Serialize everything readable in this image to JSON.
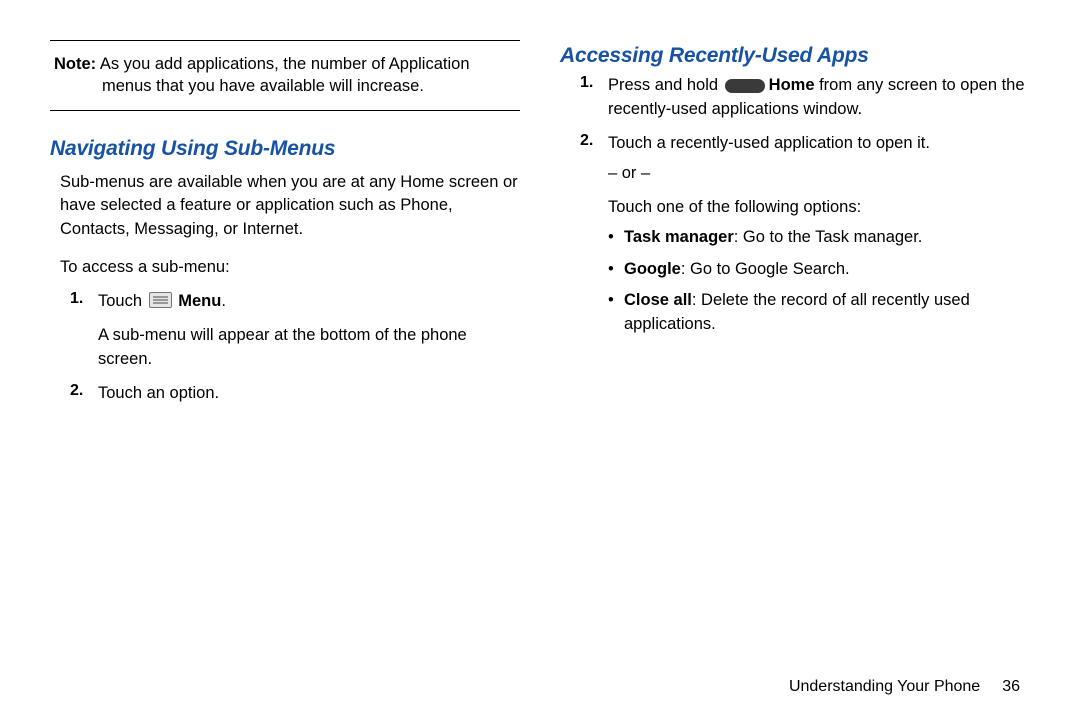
{
  "left": {
    "note": {
      "label": "Note:",
      "first": " As you add applications, the number of Application",
      "second": "menus that you have available will increase."
    },
    "heading": "Navigating Using Sub-Menus",
    "intro": "Sub-menus are available when you are at any Home screen or have selected a feature or application such as Phone, Contacts, Messaging, or Internet.",
    "lead": "To access a sub-menu:",
    "steps": {
      "s1": {
        "num": "1.",
        "pre": "Touch ",
        "menu": "Menu",
        "post": ".",
        "sub": "A sub-menu will appear at the bottom of the phone screen."
      },
      "s2": {
        "num": "2.",
        "text": "Touch an option."
      }
    }
  },
  "right": {
    "heading": "Accessing Recently-Used Apps",
    "steps": {
      "s1": {
        "num": "1.",
        "pre": "Press and hold ",
        "home": "Home",
        "post": " from any screen to open the recently-used applications window."
      },
      "s2": {
        "num": "2.",
        "text": "Touch a recently-used application to open it.",
        "or": "– or –",
        "optlead": "Touch one of the following options:",
        "opts": {
          "a": {
            "label": "Task manager",
            "rest": ": Go to the Task manager."
          },
          "b": {
            "label": "Google",
            "rest": ": Go to Google Search."
          },
          "c": {
            "label": "Close all",
            "rest": ": Delete the record of all recently used applications."
          }
        }
      }
    }
  },
  "footer": {
    "section": "Understanding Your Phone",
    "page": "36"
  }
}
